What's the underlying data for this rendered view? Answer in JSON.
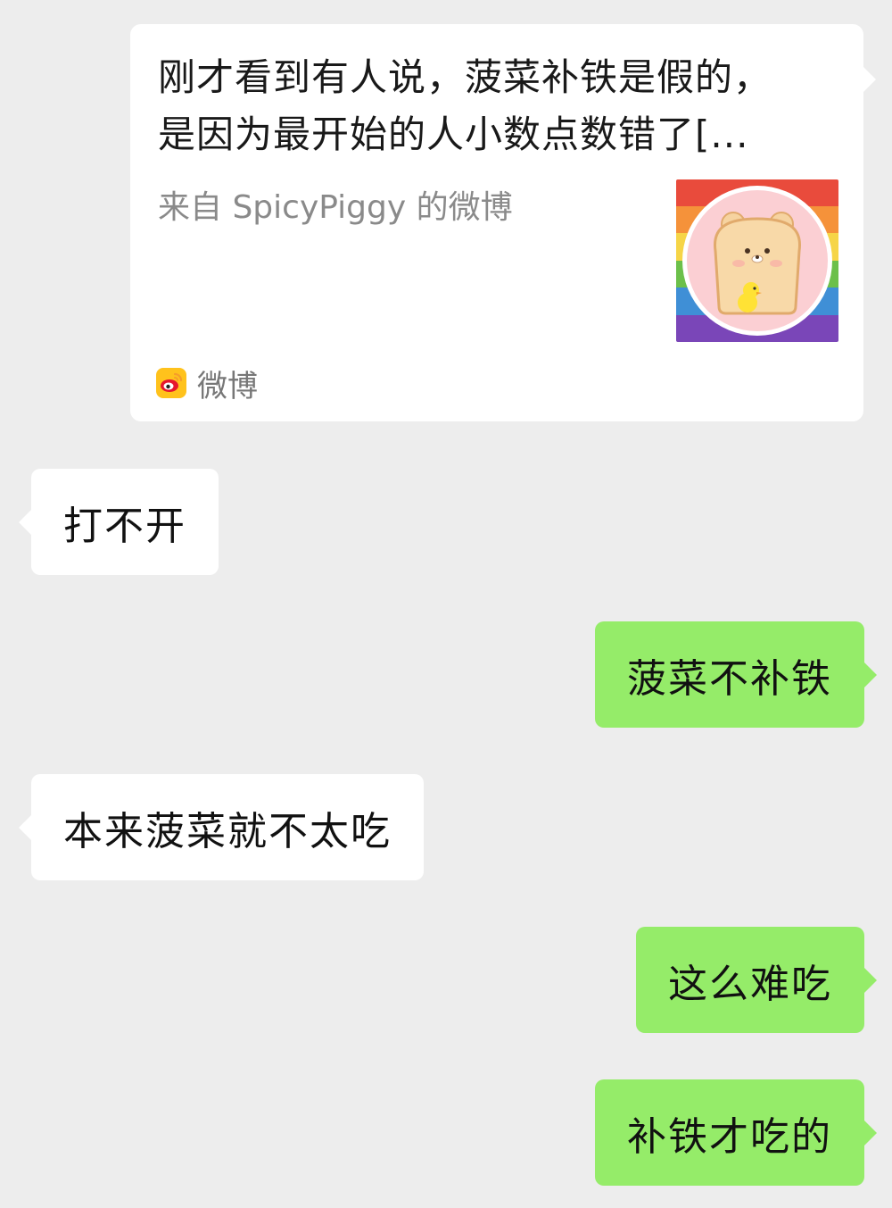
{
  "shared_card": {
    "title_lines": [
      "刚才看到有人说，菠菜补铁是假的，",
      "是因为最开始的人小数点数错了[..."
    ],
    "source": "来自 SpicyPiggy 的微博",
    "thumbnail": "bear-toast-avatar-on-rainbow",
    "app_icon": "weibo-logo-icon",
    "app_label": "微博"
  },
  "messages": [
    {
      "side": "left",
      "text": "打不开"
    },
    {
      "side": "right",
      "text": "菠菜不补铁"
    },
    {
      "side": "left",
      "text": "本来菠菜就不太吃"
    },
    {
      "side": "right",
      "text": "这么难吃"
    },
    {
      "side": "right",
      "text": "补铁才吃的"
    }
  ],
  "colors": {
    "background": "#ededed",
    "incoming_bubble": "#ffffff",
    "outgoing_bubble": "#95ec69",
    "source_text": "#8a8a8a"
  }
}
